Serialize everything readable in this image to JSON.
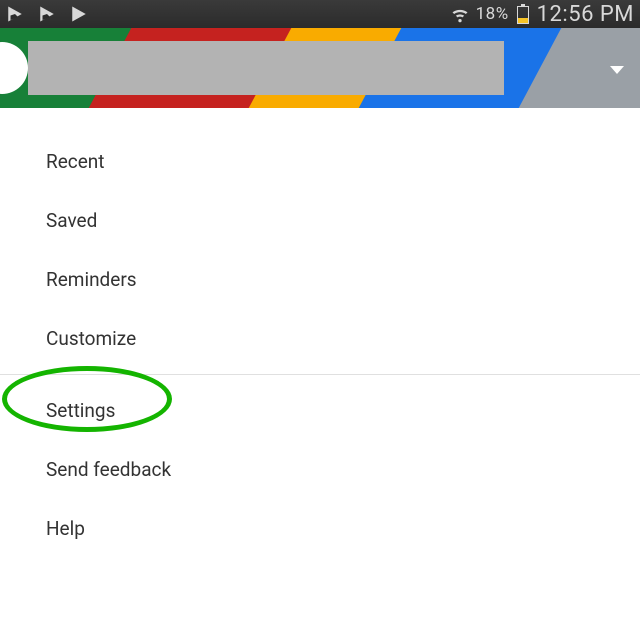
{
  "status": {
    "battery_pct": "18%",
    "time": "12:56 PM"
  },
  "menu": {
    "items": [
      {
        "label": "Recent"
      },
      {
        "label": "Saved"
      },
      {
        "label": "Reminders"
      },
      {
        "label": "Customize"
      },
      {
        "label": "Settings"
      },
      {
        "label": "Send feedback"
      },
      {
        "label": "Help"
      }
    ]
  },
  "annotation": {
    "highlighted_item": "Settings"
  }
}
